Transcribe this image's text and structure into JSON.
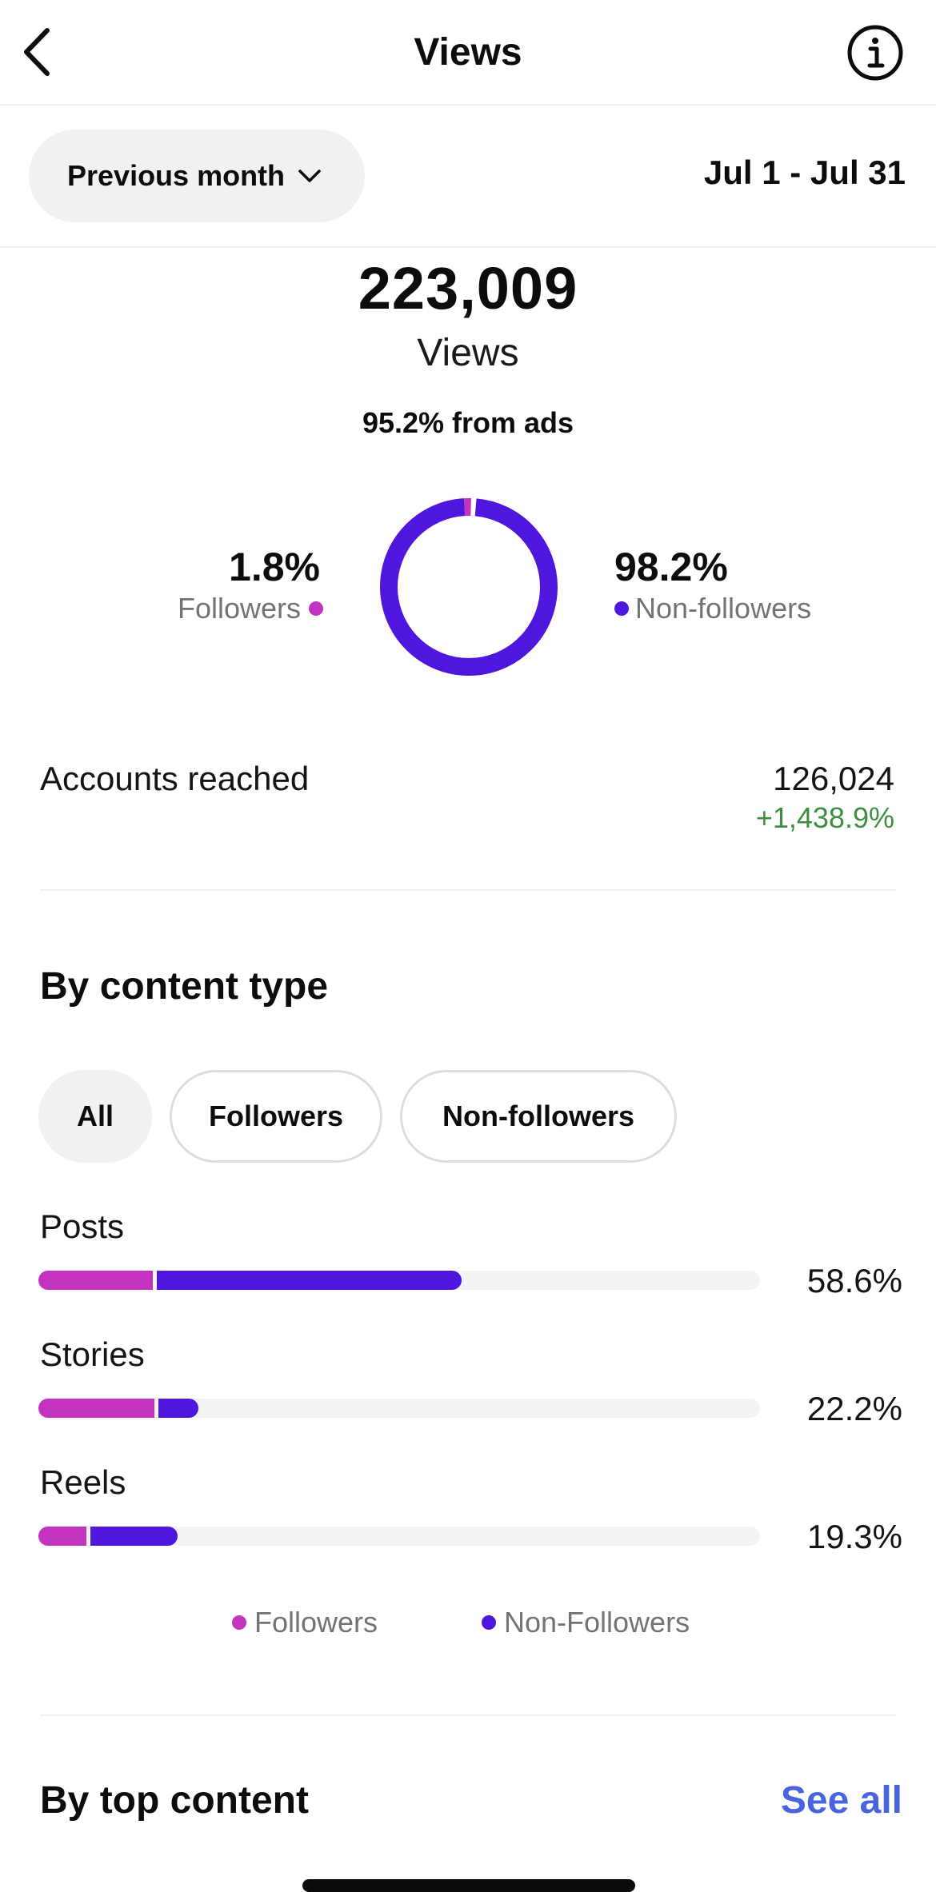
{
  "header": {
    "title": "Views",
    "back_icon": "chevron-left-icon",
    "info_icon": "info-circle-icon"
  },
  "filter": {
    "period_label": "Previous month",
    "period_icon": "chevron-down-icon",
    "date_range": "Jul 1 - Jul 31"
  },
  "summary": {
    "total_value": "223,009",
    "total_label": "Views",
    "ads_note": "95.2% from ads"
  },
  "audience_split": {
    "followers_pct_text": "1.8%",
    "followers_label": "Followers",
    "non_followers_pct_text": "98.2%",
    "non_followers_label": "Non-followers",
    "followers_share": 0.018,
    "non_followers_share": 0.982
  },
  "reach": {
    "label": "Accounts reached",
    "value": "126,024",
    "change": "+1,438.9%"
  },
  "content_type": {
    "title": "By content type",
    "chips": [
      {
        "label": "All",
        "selected": true
      },
      {
        "label": "Followers",
        "selected": false
      },
      {
        "label": "Non-followers",
        "selected": false
      }
    ],
    "rows": [
      {
        "label": "Posts",
        "pct_text": "58.6%",
        "followers_fraction": 0.158,
        "non_followers_fraction": 0.428
      },
      {
        "label": "Stories",
        "pct_text": "22.2%",
        "followers_fraction": 0.161,
        "non_followers_fraction": 0.061
      },
      {
        "label": "Reels",
        "pct_text": "19.3%",
        "followers_fraction": 0.066,
        "non_followers_fraction": 0.127
      }
    ],
    "legend": {
      "followers": "Followers",
      "non_followers": "Non-Followers"
    }
  },
  "top_content": {
    "title": "By top content",
    "see_all": "See all"
  },
  "colors": {
    "followers": "#c234c0",
    "non_followers": "#4f16de",
    "positive_change": "#3e8e41",
    "link": "#4964e0",
    "chip_bg": "#eff1f3",
    "track_bg": "#f1f3f5"
  }
}
